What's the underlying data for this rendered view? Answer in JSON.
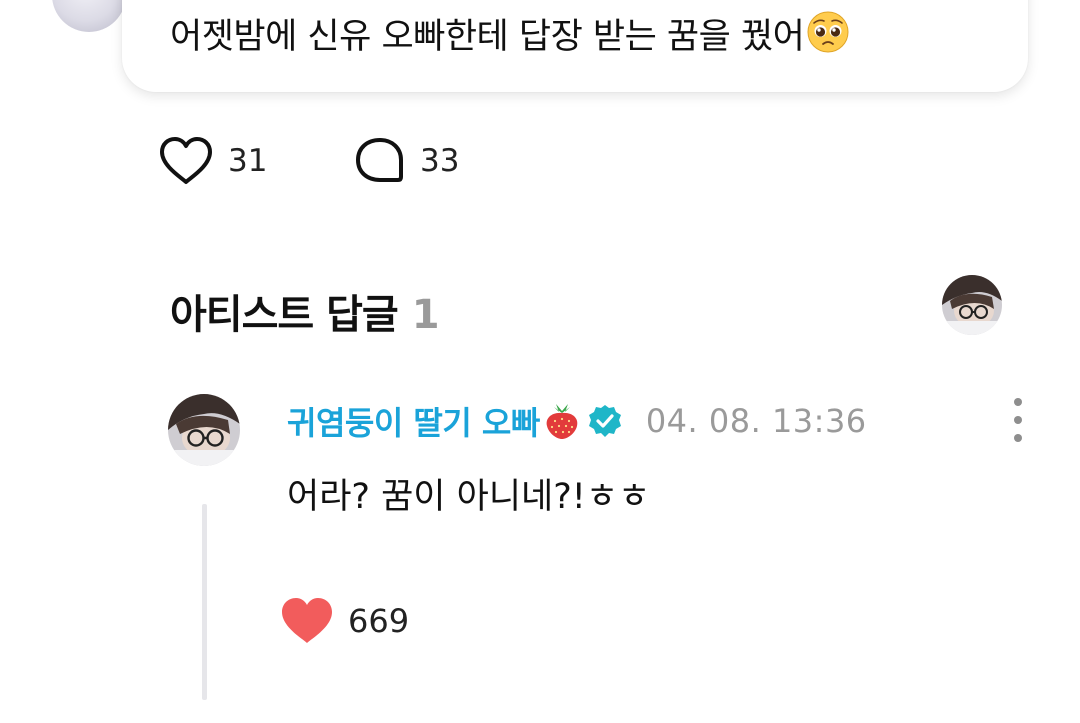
{
  "post": {
    "text": "어젯밤에 신유 오빠한테 답장 받는 꿈을 꿨어",
    "emoji": "pleading-face-emoji",
    "likes": "31",
    "comments": "33"
  },
  "artist_replies": {
    "title": "아티스트 답글",
    "count": "1"
  },
  "reply": {
    "author": "귀염둥이 딸기 오빠",
    "timestamp": "04. 08. 13:36",
    "text": "어라? 꿈이 아니네?!ㅎㅎ",
    "likes": "669"
  },
  "colors": {
    "author": "#1aa3d9",
    "liked_heart": "#f25c5c",
    "verified": "#1fb6c8",
    "muted": "#9a9a9a"
  }
}
